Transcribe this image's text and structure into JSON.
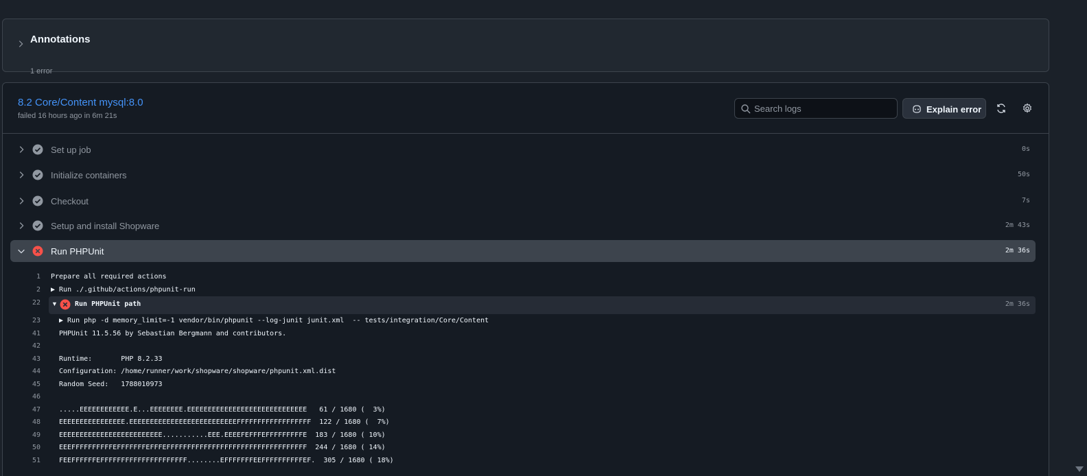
{
  "annotations": {
    "title": "Annotations",
    "subtitle": "1 error"
  },
  "job": {
    "title": "8.2 Core/Content mysql:8.0",
    "meta": "failed 16 hours ago in 6m 21s",
    "search_placeholder": "Search logs",
    "explain_label": "Explain error"
  },
  "steps": [
    {
      "name": "Set up job",
      "duration": "0s",
      "status": "success"
    },
    {
      "name": "Initialize containers",
      "duration": "50s",
      "status": "success"
    },
    {
      "name": "Checkout",
      "duration": "7s",
      "status": "success"
    },
    {
      "name": "Setup and install Shopware",
      "duration": "2m 43s",
      "status": "success"
    },
    {
      "name": "Run PHPUnit",
      "duration": "2m 36s",
      "status": "failed"
    }
  ],
  "log": {
    "pre": [
      {
        "n": "1",
        "text": "Prepare all required actions"
      },
      {
        "n": "2",
        "text": "▶ Run ./.github/actions/phpunit-run"
      }
    ],
    "group": {
      "n": "22",
      "name": "Run PHPUnit path",
      "duration": "2m 36s"
    },
    "lines": [
      {
        "n": "23",
        "text": "▶ Run php -d memory_limit=-1 vendor/bin/phpunit --log-junit junit.xml  -- tests/integration/Core/Content"
      },
      {
        "n": "41",
        "text": "PHPUnit 11.5.56 by Sebastian Bergmann and contributors."
      },
      {
        "n": "42",
        "text": ""
      },
      {
        "n": "43",
        "text": "Runtime:       PHP 8.2.33"
      },
      {
        "n": "44",
        "text": "Configuration: /home/runner/work/shopware/shopware/phpunit.xml.dist"
      },
      {
        "n": "45",
        "text": "Random Seed:   1788010973"
      },
      {
        "n": "46",
        "text": ""
      },
      {
        "n": "47",
        "text": ".....EEEEEEEEEEEE.E...EEEEEEEE.EEEEEEEEEEEEEEEEEEEEEEEEEEEEE   61 / 1680 (  3%)"
      },
      {
        "n": "48",
        "text": "EEEEEEEEEEEEEEEE.EEEEEEEEEEEEEEEEEEEEEEEEEEFFFFFFFFFFFFFFFFFF  122 / 1680 (  7%)"
      },
      {
        "n": "49",
        "text": "EEEEEEEEEEEEEEEEEEEEEEEEE...........EEE.EEEEFEFFFEFFFFFFFFFE  183 / 1680 ( 10%)"
      },
      {
        "n": "50",
        "text": "EEEFFFFFFFFFFEFFFFFFFEFFFEFFFFFFFFFFFFFFFFFFFFFFFFFFFFFFFFFF  244 / 1680 ( 14%)"
      },
      {
        "n": "51",
        "text": "FEEFFFFFFEFFFFFFFFFFFFFFFFFFFFF........EFFFFFFFEEFFFFFFFFFFEF.  305 / 1680 ( 18%)"
      }
    ]
  }
}
